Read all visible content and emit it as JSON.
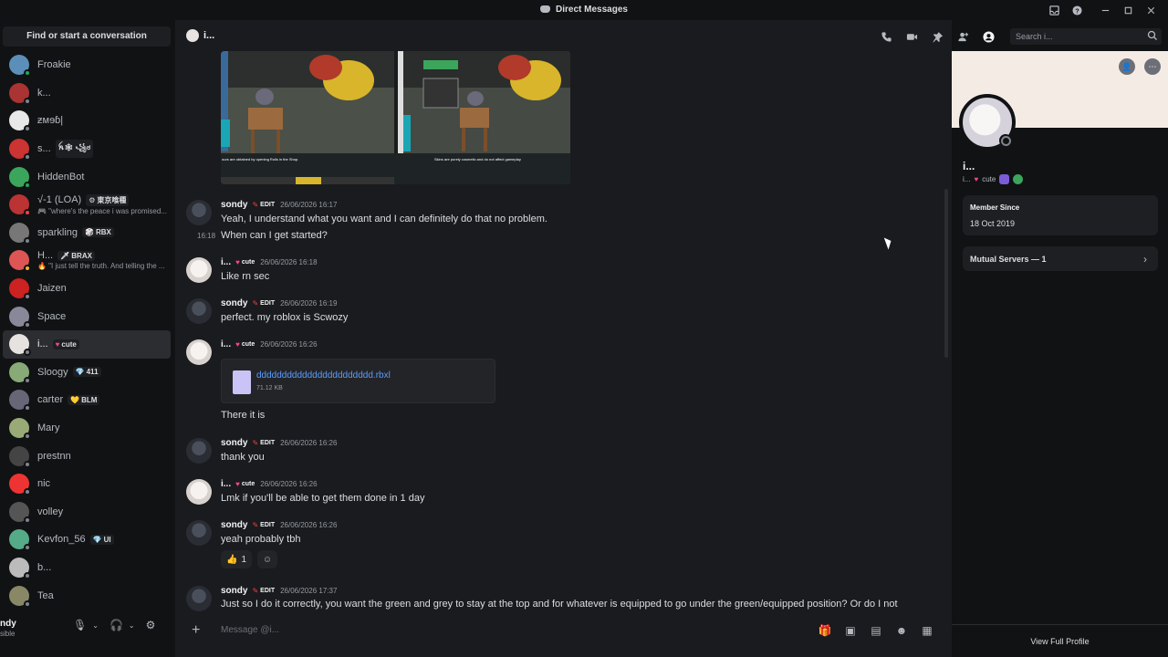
{
  "window": {
    "title": "Direct Messages",
    "icons": [
      "inbox-icon",
      "help-icon",
      "minimize-icon",
      "maximize-icon",
      "close-icon"
    ]
  },
  "sidebar": {
    "find_label": "Find or start a conversation",
    "items": [
      {
        "name": "Froakie",
        "sub": "",
        "tag": "",
        "tag_glyph": "",
        "color": "#5b8fb9",
        "status": "online"
      },
      {
        "name": "k...",
        "sub": "",
        "tag": "",
        "tag_glyph": "",
        "color": "#a33",
        "status": "offline"
      },
      {
        "name": "ƶмɘɓ|",
        "sub": "",
        "tag": "",
        "tag_glyph": "",
        "color": "#e8e8e8",
        "status": "offline"
      },
      {
        "name": "s...",
        "sub": "",
        "tag": "ꫝ🕸 ꧁ಠ",
        "tag_glyph": "",
        "color": "#c33",
        "status": "offline"
      },
      {
        "name": "HiddenBot",
        "sub": "",
        "tag": "",
        "tag_glyph": "",
        "color": "#3ba55c",
        "status": "online"
      },
      {
        "name": "√-1 (LOA)",
        "sub": "🎮 \"where's the peace i was promised...",
        "tag": "東京喰種",
        "tag_glyph": "⚙",
        "color": "#b33",
        "status": "dnd"
      },
      {
        "name": "sparkling",
        "sub": "",
        "tag": "RBX",
        "tag_glyph": "🎲",
        "color": "#777",
        "status": "offline"
      },
      {
        "name": "H...",
        "sub": "🔥 \"I just tell the truth. And telling the ...",
        "tag": "BRAX",
        "tag_glyph": "🗡",
        "color": "#d55",
        "status": "idle"
      },
      {
        "name": "Jaizen",
        "sub": "",
        "tag": "",
        "tag_glyph": "",
        "color": "#c22",
        "status": "offline"
      },
      {
        "name": "Space",
        "sub": "",
        "tag": "",
        "tag_glyph": "",
        "color": "#889",
        "status": "offline"
      },
      {
        "name": "i...",
        "sub": "",
        "tag": "cute",
        "tag_glyph": "♥",
        "color": "#e5e2e0",
        "status": "offline",
        "active": true
      },
      {
        "name": "Sloogy",
        "sub": "",
        "tag": "411",
        "tag_glyph": "💎",
        "color": "#8a7",
        "status": "offline"
      },
      {
        "name": "carter",
        "sub": "",
        "tag": "BLM",
        "tag_glyph": "💛",
        "color": "#667",
        "status": "offline"
      },
      {
        "name": "Mary",
        "sub": "",
        "tag": "",
        "tag_glyph": "",
        "color": "#9a7",
        "status": "offline"
      },
      {
        "name": "prestnn",
        "sub": "",
        "tag": "",
        "tag_glyph": "",
        "color": "#444",
        "status": "offline"
      },
      {
        "name": "nic",
        "sub": "",
        "tag": "",
        "tag_glyph": "",
        "color": "#e33",
        "status": "offline"
      },
      {
        "name": "volley",
        "sub": "",
        "tag": "",
        "tag_glyph": "",
        "color": "#555",
        "status": "offline"
      },
      {
        "name": "Kevfon_56",
        "sub": "",
        "tag": "UI",
        "tag_glyph": "💎",
        "color": "#5a8",
        "status": "offline"
      },
      {
        "name": "b...",
        "sub": "",
        "tag": "",
        "tag_glyph": "",
        "color": "#bbb",
        "status": "offline"
      },
      {
        "name": "Tea",
        "sub": "",
        "tag": "",
        "tag_glyph": "",
        "color": "#886",
        "status": "offline"
      }
    ],
    "user": {
      "name": "ndy",
      "status": "sible"
    }
  },
  "chat": {
    "recipient": "i...",
    "search_placeholder": "Search i...",
    "composer_placeholder": "Message @i...",
    "image_captions": [
      "ours are obtained by opening Rolls in the Shop.",
      "Skins are purely cosmetic and do not affect gameplay"
    ],
    "messages": [
      {
        "author": "sondy",
        "tag": "EDIT",
        "ts": "26/06/2026 16:17",
        "lines": [
          "Yeah, I understand what you want and I can definitely do that no problem.",
          "When can I get started?"
        ],
        "side_ts": "16:18"
      },
      {
        "author": "i...",
        "tag": "cute",
        "ts": "26/06/2026 16:18",
        "lines": [
          "Like rn sec"
        ]
      },
      {
        "author": "sondy",
        "tag": "EDIT",
        "ts": "26/06/2026 16:19",
        "lines": [
          "perfect. my roblox is Scwozy"
        ]
      },
      {
        "author": "i...",
        "tag": "cute",
        "ts": "26/06/2026 16:26",
        "lines": [
          "There it is"
        ],
        "file": {
          "name": "ddddddddddddddddddddddd.rbxl",
          "size": "71.12 KB"
        }
      },
      {
        "author": "sondy",
        "tag": "EDIT",
        "ts": "26/06/2026 16:26",
        "lines": [
          "thank you"
        ]
      },
      {
        "author": "i...",
        "tag": "cute",
        "ts": "26/06/2026 16:26",
        "lines": [
          "Lmk if you'll be able to get them done in 1 day"
        ]
      },
      {
        "author": "sondy",
        "tag": "EDIT",
        "ts": "26/06/2026 16:26",
        "lines": [
          "yeah probably tbh"
        ],
        "reaction": {
          "emoji": "👍",
          "count": "1"
        }
      },
      {
        "author": "sondy",
        "tag": "EDIT",
        "ts": "26/06/2026 17:37",
        "lines": [
          "Just so I do it correctly, you want the green and grey to stay at the top and for whatever is equipped to go under the green/equipped position? Or do I not"
        ]
      }
    ]
  },
  "profile": {
    "name": "i...",
    "tag_prefix": "i...",
    "tag": "cute",
    "member_since_label": "Member Since",
    "member_since": "18 Oct 2019",
    "mutual_servers": "Mutual Servers — 1",
    "view_full": "View Full Profile"
  }
}
